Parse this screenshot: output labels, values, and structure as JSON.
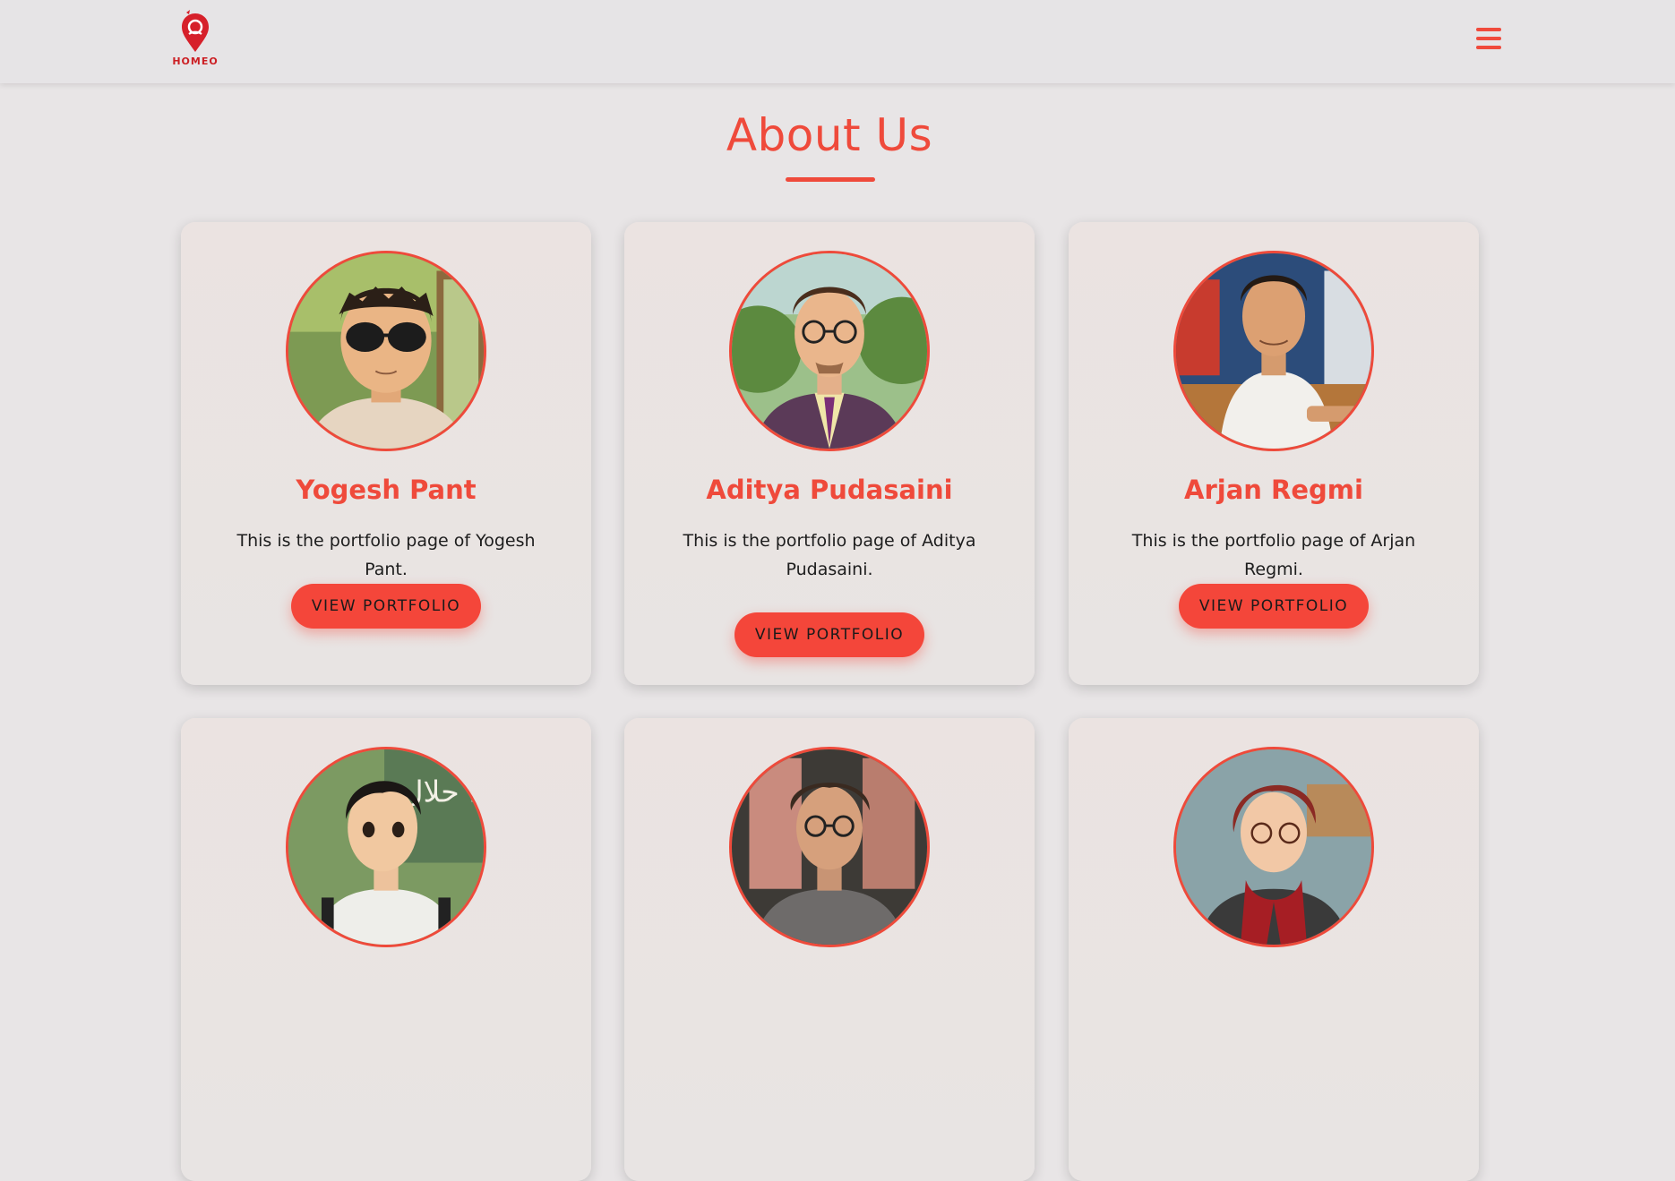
{
  "header": {
    "logo_text": "HOMEO",
    "menu_icon": "hamburger-menu-icon"
  },
  "page": {
    "title": "About Us"
  },
  "colors": {
    "accent": "#ef4a3b",
    "button": "#f4463a",
    "background": "#e8e5e6",
    "card": "#ebe4e2",
    "logo": "#cc1f24"
  },
  "cards": [
    {
      "name": "Yogesh Pant",
      "description": "This is the portfolio page of Yogesh Pant.",
      "button": "VIEW PORTFOLIO",
      "avatar": "avatar-yogesh-pant"
    },
    {
      "name": "Aditya Pudasaini",
      "description": "This is the portfolio page of Aditya Pudasaini.",
      "button": "VIEW PORTFOLIO",
      "avatar": "avatar-aditya-pudasaini"
    },
    {
      "name": "Arjan Regmi",
      "description": "This is the portfolio page of Arjan Regmi.",
      "button": "VIEW PORTFOLIO",
      "avatar": "avatar-arjan-regmi"
    },
    {
      "avatar": "avatar-member-4",
      "avatar_sign_text": "حلال HALAL"
    },
    {
      "avatar": "avatar-member-5"
    },
    {
      "avatar": "avatar-member-6"
    }
  ]
}
